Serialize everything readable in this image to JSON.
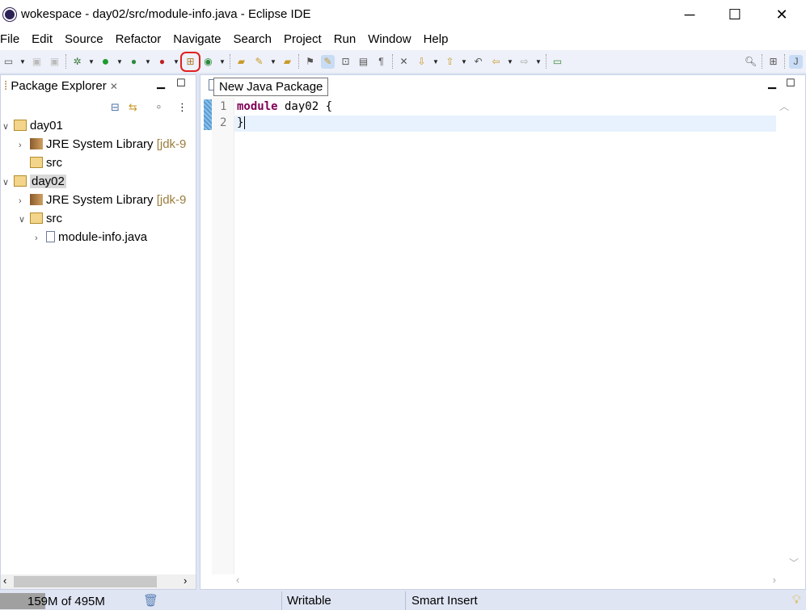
{
  "window": {
    "title": "wokespace - day02/src/module-info.java - Eclipse IDE"
  },
  "menu": [
    "File",
    "Edit",
    "Source",
    "Refactor",
    "Navigate",
    "Search",
    "Project",
    "Run",
    "Window",
    "Help"
  ],
  "toolbar": {
    "tooltip": "New Java Package",
    "highlight_color": "#e02020"
  },
  "package_explorer": {
    "title": "Package Explorer",
    "tree": [
      {
        "label": "day01",
        "expanded": true,
        "level": 0,
        "icon": "project-icon"
      },
      {
        "label": "JRE System Library",
        "decoration": "[jdk-9",
        "level": 1,
        "icon": "library-icon"
      },
      {
        "label": "src",
        "level": 1,
        "icon": "source-folder-icon"
      },
      {
        "label": "day02",
        "expanded": true,
        "level": 0,
        "icon": "project-icon",
        "selected": true
      },
      {
        "label": "JRE System Library",
        "decoration": "[jdk-9",
        "level": 1,
        "icon": "library-icon"
      },
      {
        "label": "src",
        "expanded": true,
        "level": 1,
        "icon": "source-folder-icon"
      },
      {
        "label": "module-info.java",
        "level": 2,
        "icon": "java-file-icon"
      }
    ]
  },
  "editor": {
    "lines": [
      {
        "num": "1",
        "keyword": "module",
        "rest": " day02 {"
      },
      {
        "num": "2",
        "rest": "}"
      }
    ]
  },
  "status": {
    "memory": "159M of 495M",
    "writable": "Writable",
    "insert_mode": "Smart Insert"
  }
}
